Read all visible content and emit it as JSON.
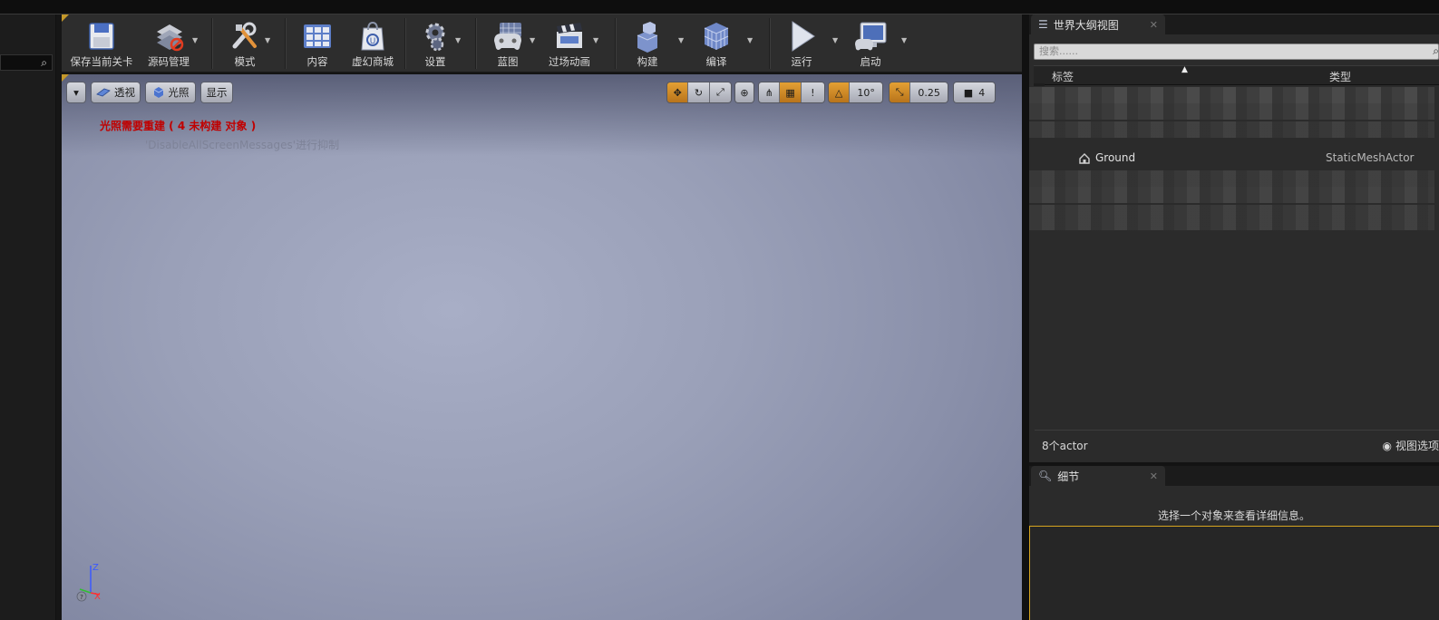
{
  "toolbar": {
    "save_label": "保存当前关卡",
    "source_control_label": "源码管理",
    "modes_label": "模式",
    "content_label": "内容",
    "marketplace_label": "虚幻商城",
    "settings_label": "设置",
    "blueprints_label": "蓝图",
    "cinematics_label": "过场动画",
    "build_label": "构建",
    "compile_label": "编译",
    "play_label": "运行",
    "launch_label": "启动"
  },
  "viewport": {
    "dropdown_symbol": "▾",
    "perspective_label": "透视",
    "lit_label": "光照",
    "show_label": "显示",
    "snap_translate_value": "",
    "grid_snap_value": "!",
    "rotation_snap_value": "10°",
    "scale_snap_value": "0.25",
    "camera_speed_value": "4",
    "lighting_warning": "光照需要重建 ( 4 未构建 对象 )",
    "suppress_hint": "'DisableAllScreenMessages'进行抑制",
    "axis_z": "Z",
    "axis_x": "X"
  },
  "outliner": {
    "tab_title": "世界大纲视图",
    "search_placeholder": "搜索......",
    "col_label": "标签",
    "col_type": "类型",
    "visible_row": {
      "name": "Ground",
      "type": "StaticMeshActor"
    },
    "actor_count": "8个actor",
    "view_options_label": "视图选项"
  },
  "details": {
    "tab_title": "细节",
    "empty_message": "选择一个对象来查看详细信息。"
  },
  "colors": {
    "accent_orange": "#e09a2a",
    "warning_red": "#c00000",
    "focus_outline": "#d6a41f"
  }
}
